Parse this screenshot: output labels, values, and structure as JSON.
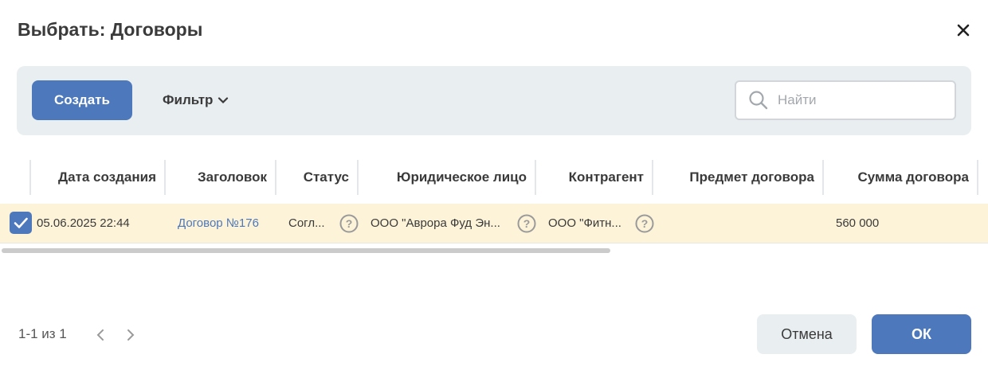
{
  "dialog": {
    "title": "Выбрать: Договоры",
    "close_icon": "close-icon"
  },
  "toolbar": {
    "create_label": "Создать",
    "filter_label": "Фильтр",
    "search_placeholder": "Найти"
  },
  "table": {
    "columns": [
      "Дата создания",
      "Заголовок",
      "Статус",
      "Юридическое лицо",
      "Контрагент",
      "Предмет договора",
      "Сумма договора"
    ],
    "rows": [
      {
        "selected": true,
        "date": "05.06.2025 22:44",
        "title": "Договор №176",
        "status": "Согл...",
        "legal_entity": "ООО \"Аврора Фуд Эн...",
        "counterparty": "ООО \"Фитн...",
        "subject": "",
        "amount": "560 000"
      }
    ]
  },
  "pagination": {
    "text": "1-1 из 1"
  },
  "footer": {
    "cancel_label": "Отмена",
    "ok_label": "ОК"
  },
  "colors": {
    "accent": "#4d78bc",
    "toolbar_bg": "#e9eef1",
    "selected_row_bg": "#fdf3d8"
  }
}
